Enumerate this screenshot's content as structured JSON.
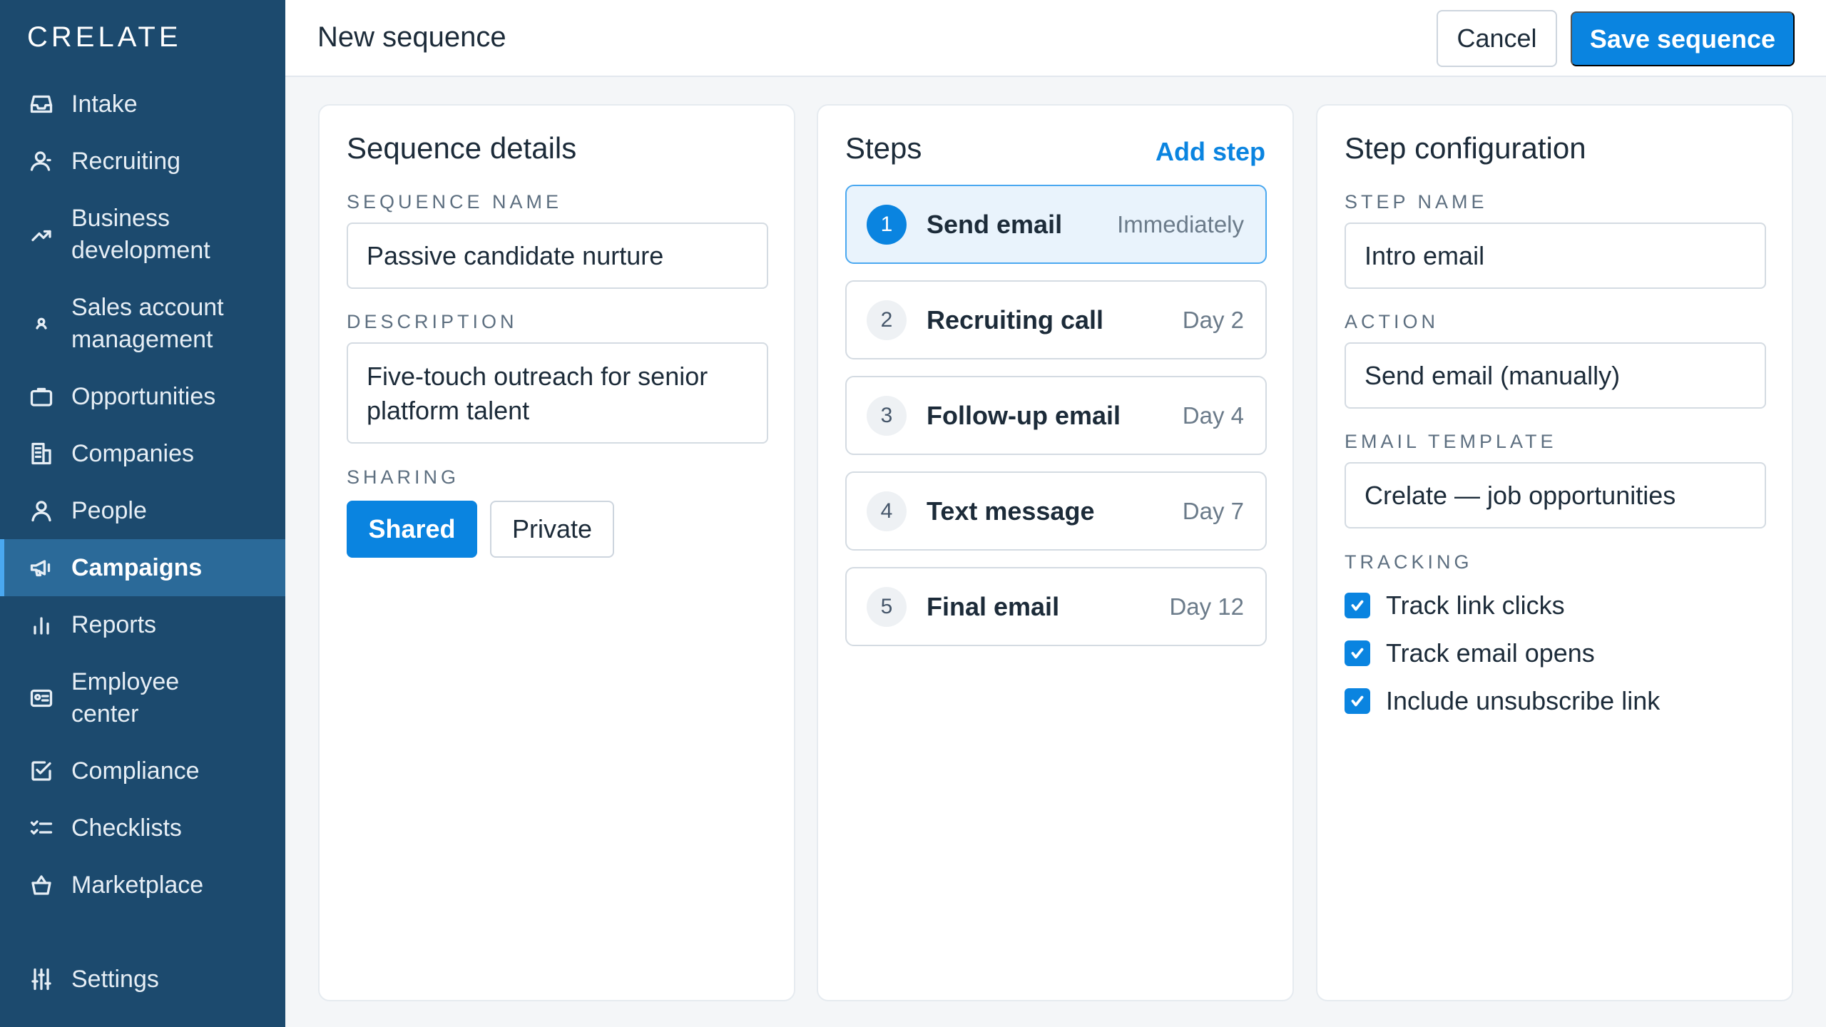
{
  "app": {
    "logo": "CRELATE"
  },
  "sidebar": {
    "items": [
      {
        "label": "Intake",
        "icon": "inbox-icon"
      },
      {
        "label": "Recruiting",
        "icon": "user-icon"
      },
      {
        "label": "Business development",
        "icon": "trend-up-icon"
      },
      {
        "label": "Sales account management",
        "icon": "person-small-icon"
      },
      {
        "label": "Opportunities",
        "icon": "briefcase-icon"
      },
      {
        "label": "Companies",
        "icon": "building-icon"
      },
      {
        "label": "People",
        "icon": "person-icon"
      },
      {
        "label": "Campaigns",
        "icon": "megaphone-icon",
        "active": true
      },
      {
        "label": "Reports",
        "icon": "bar-chart-icon"
      },
      {
        "label": "Employee center",
        "icon": "id-card-icon"
      },
      {
        "label": "Compliance",
        "icon": "checkbox-icon"
      },
      {
        "label": "Checklists",
        "icon": "checklist-icon"
      },
      {
        "label": "Marketplace",
        "icon": "basket-icon"
      }
    ],
    "settings": {
      "label": "Settings",
      "icon": "sliders-icon"
    }
  },
  "header": {
    "title": "New sequence",
    "cancel_label": "Cancel",
    "save_label": "Save sequence"
  },
  "details": {
    "title": "Sequence details",
    "name_label": "SEQUENCE NAME",
    "name_value": "Passive candidate nurture",
    "description_label": "DESCRIPTION",
    "description_value": "Five-touch outreach for senior platform talent",
    "sharing_label": "SHARING",
    "sharing_options": [
      "Shared",
      "Private"
    ],
    "sharing_selected": "Shared"
  },
  "steps": {
    "title": "Steps",
    "add_label": "Add step",
    "items": [
      {
        "num": "1",
        "name": "Send email",
        "when": "Immediately",
        "active": true
      },
      {
        "num": "2",
        "name": "Recruiting call",
        "when": "Day 2"
      },
      {
        "num": "3",
        "name": "Follow-up email",
        "when": "Day 4"
      },
      {
        "num": "4",
        "name": "Text message",
        "when": "Day 7"
      },
      {
        "num": "5",
        "name": "Final email",
        "when": "Day 12"
      }
    ]
  },
  "config": {
    "title": "Step configuration",
    "step_name_label": "STEP NAME",
    "step_name_value": "Intro email",
    "action_label": "ACTION",
    "action_value": "Send email (manually)",
    "template_label": "EMAIL TEMPLATE",
    "template_value": "Crelate — job opportunities",
    "tracking_label": "TRACKING",
    "tracking": [
      {
        "label": "Track link clicks",
        "checked": true
      },
      {
        "label": "Track email opens",
        "checked": true
      },
      {
        "label": "Include unsubscribe link",
        "checked": true
      }
    ]
  },
  "colors": {
    "sidebar": "#1c4a6e",
    "sidebar_active": "#2b6a99",
    "accent": "#0a84e0",
    "background": "#f4f6f8"
  }
}
